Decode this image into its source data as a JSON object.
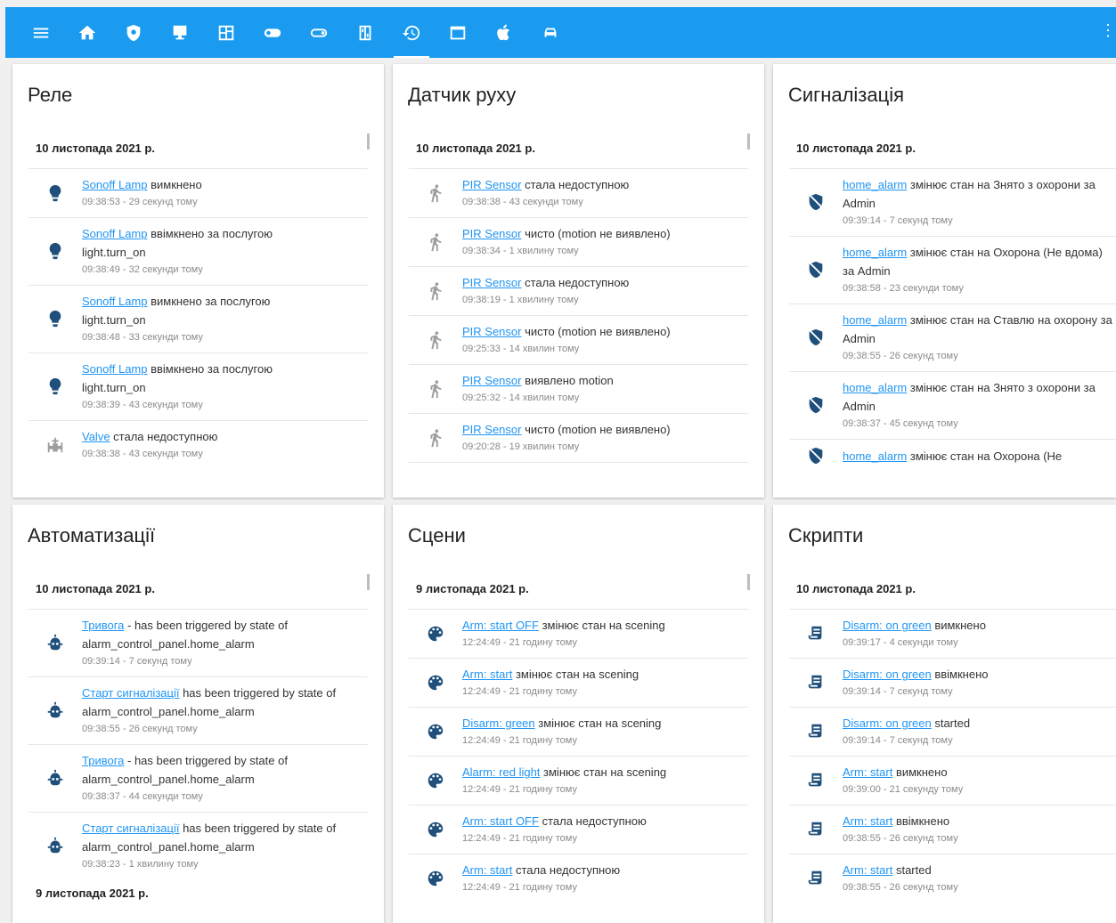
{
  "toolbar": {
    "icons": [
      "menu-icon",
      "home-icon",
      "shield-icon",
      "monitor-icon",
      "floorplan-icon",
      "toggle-on-icon",
      "toggle-off-icon",
      "switch-panel-icon",
      "history-icon",
      "window-icon",
      "apple-icon",
      "car-icon"
    ],
    "accent": "#1b9bef"
  },
  "cards": {
    "rele": {
      "title": "Реле",
      "date": "10 листопада 2021 р.",
      "entries": [
        {
          "link": "Sonoff Lamp",
          "text": " вимкнено",
          "extra": "",
          "time": "09:38:53 - 29 секунд тому"
        },
        {
          "link": "Sonoff Lamp",
          "text": " ввімкнено за послугою",
          "extra": "light.turn_on",
          "time": "09:38:49 - 32 секунди тому"
        },
        {
          "link": "Sonoff Lamp",
          "text": " вимкнено за послугою",
          "extra": "light.turn_on",
          "time": "09:38:48 - 33 секунди тому"
        },
        {
          "link": "Sonoff Lamp",
          "text": " ввімкнено за послугою",
          "extra": "light.turn_on",
          "time": "09:38:39 - 43 секунди тому"
        },
        {
          "link": "Valve",
          "text": " стала недоступною",
          "extra": "",
          "time": "09:38:38 - 43 секунди тому"
        }
      ]
    },
    "motion": {
      "title": "Датчик руху",
      "date": "10 листопада 2021 р.",
      "entries": [
        {
          "link": "PIR Sensor",
          "text": " стала недоступною",
          "time": "09:38:38 - 43 секунди тому"
        },
        {
          "link": "PIR Sensor",
          "text": " чисто (motion не виявлено)",
          "time": "09:38:34 - 1 хвилину тому"
        },
        {
          "link": "PIR Sensor",
          "text": " стала недоступною",
          "time": "09:38:19 - 1 хвилину тому"
        },
        {
          "link": "PIR Sensor",
          "text": " чисто (motion не виявлено)",
          "time": "09:25:33 - 14 хвилин тому"
        },
        {
          "link": "PIR Sensor",
          "text": " виявлено motion",
          "time": "09:25:32 - 14 хвилин тому"
        },
        {
          "link": "PIR Sensor",
          "text": " чисто (motion не виявлено)",
          "time": "09:20:28 - 19 хвилин тому"
        }
      ]
    },
    "alarm": {
      "title": "Сигналізація",
      "date": "10 листопада 2021 р.",
      "entries": [
        {
          "link": "home_alarm",
          "text": " змінює стан на Знято з охорони за Admin",
          "time": "09:39:14 - 7 секунд тому"
        },
        {
          "link": "home_alarm",
          "text": " змінює стан на Охорона (Не вдома) за Admin",
          "time": "09:38:58 - 23 секунди тому"
        },
        {
          "link": "home_alarm",
          "text": " змінює стан на Ставлю на охорону за Admin",
          "time": "09:38:55 - 26 секунд тому"
        },
        {
          "link": "home_alarm",
          "text": " змінює стан на Знято з охорони за Admin",
          "time": "09:38:37 - 45 секунд тому"
        },
        {
          "link": "home_alarm",
          "text": " змінює стан на Охорона (Не",
          "time": ""
        }
      ]
    },
    "automations": {
      "title": "Автоматизації",
      "date": "10 листопада 2021 р.",
      "entries": [
        {
          "link": "Тривога",
          "text": " - has been triggered by state of alarm_control_panel.home_alarm",
          "time": "09:39:14 - 7 секунд тому"
        },
        {
          "link": "Старт сигналізації",
          "text": " has been triggered by state of alarm_control_panel.home_alarm",
          "time": "09:38:55 - 26 секунд тому"
        },
        {
          "link": "Тривога",
          "text": " - has been triggered by state of alarm_control_panel.home_alarm",
          "time": "09:38:37 - 44 секунди тому"
        },
        {
          "link": "Старт сигналізації",
          "text": " has been triggered by state of alarm_control_panel.home_alarm",
          "time": "09:38:23 - 1 хвилину тому"
        }
      ],
      "date2": "9 листопада 2021 р."
    },
    "scenes": {
      "title": "Сцени",
      "date": "9 листопада 2021 р.",
      "entries": [
        {
          "link": "Arm: start OFF",
          "text": " змінює стан на scening",
          "time": "12:24:49 - 21 годину тому"
        },
        {
          "link": "Arm: start",
          "text": " змінює стан на scening",
          "time": "12:24:49 - 21 годину тому"
        },
        {
          "link": "Disarm: green",
          "text": " змінює стан на scening",
          "time": "12:24:49 - 21 годину тому"
        },
        {
          "link": "Alarm: red light",
          "text": " змінює стан на scening",
          "time": "12:24:49 - 21 годину тому"
        },
        {
          "link": "Arm: start OFF",
          "text": " стала недоступною",
          "time": "12:24:49 - 21 годину тому"
        },
        {
          "link": "Arm: start",
          "text": " стала недоступною",
          "time": "12:24:49 - 21 годину тому"
        }
      ]
    },
    "scripts": {
      "title": "Скрипти",
      "date": "10 листопада 2021 р.",
      "entries": [
        {
          "link": "Disarm: on green",
          "text": " вимкнено",
          "time": "09:39:17 - 4 секунди тому"
        },
        {
          "link": "Disarm: on green",
          "text": " ввімкнено",
          "time": "09:39:14 - 7 секунд тому"
        },
        {
          "link": "Disarm: on green",
          "text": " started",
          "time": "09:39:14 - 7 секунд тому"
        },
        {
          "link": "Arm: start",
          "text": " вимкнено",
          "time": "09:39:00 - 21 секунду тому"
        },
        {
          "link": "Arm: start",
          "text": " ввімкнено",
          "time": "09:38:55 - 26 секунд тому"
        },
        {
          "link": "Arm: start",
          "text": " started",
          "time": "09:38:55 - 26 секунд тому"
        }
      ]
    }
  },
  "colors": {
    "link": "#2196f3",
    "icon_blue": "#1f4f7a"
  }
}
